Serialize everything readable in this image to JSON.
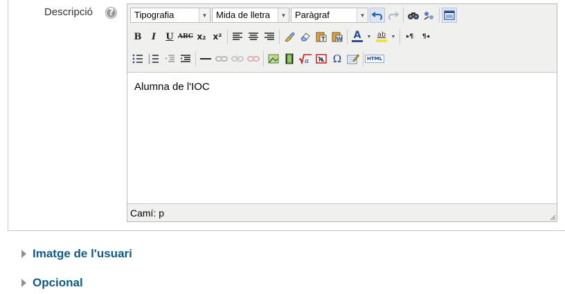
{
  "field": {
    "label": "Descripció",
    "help_icon": "question-circle-icon"
  },
  "editor": {
    "combos": [
      {
        "name": "font-family-select",
        "value": "Tipografia"
      },
      {
        "name": "font-size-select",
        "value": "Mida de lletra"
      },
      {
        "name": "format-select",
        "value": "Paràgraf"
      }
    ],
    "row2": {
      "bold": "B",
      "italic": "I",
      "underline": "U",
      "strike": "ABC",
      "sub": "x₂",
      "sup": "x²"
    },
    "row3": {
      "html": "HTML"
    },
    "content": "Alumna de l'IOC",
    "status_path": "Camí: p"
  },
  "sections": [
    {
      "label": "Imatge de l'usuari",
      "icon": "collapsed-triangle-icon"
    },
    {
      "label": "Opcional",
      "icon": "collapsed-triangle-icon"
    }
  ],
  "colors": {
    "link": "#0f5b86",
    "toolbar_bg": "#f0f0ee",
    "highlight": "#dde6f2"
  }
}
